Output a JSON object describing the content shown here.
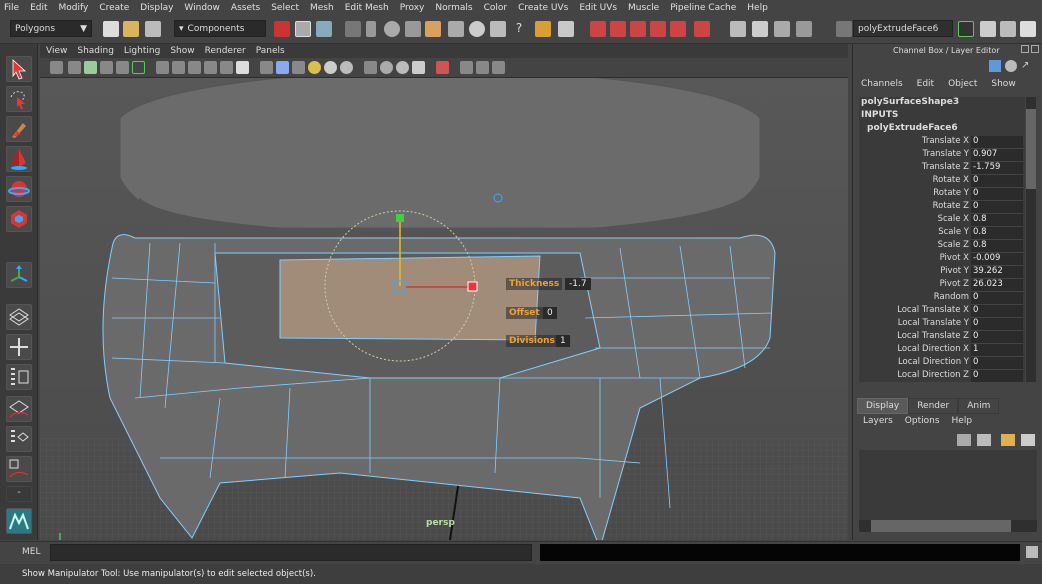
{
  "menubar": {
    "items": [
      "File",
      "Edit",
      "Modify",
      "Create",
      "Display",
      "Window",
      "Assets",
      "Select",
      "Mesh",
      "Edit Mesh",
      "Proxy",
      "Normals",
      "Color",
      "Create UVs",
      "Edit UVs",
      "Muscle",
      "Pipeline Cache",
      "Help"
    ]
  },
  "toolbar": {
    "mode": "Polygons",
    "selection_mode": "Components",
    "object_field": "polyExtrudeFace6"
  },
  "panel_menu": {
    "items": [
      "View",
      "Shading",
      "Lighting",
      "Show",
      "Renderer",
      "Panels"
    ]
  },
  "viewport": {
    "camera_label": "persp",
    "hud": {
      "thickness_label": "Thickness",
      "thickness_value": "-1.7",
      "offset_label": "Offset",
      "offset_value": "0",
      "divisions_label": "Divisions",
      "divisions_value": "1"
    }
  },
  "channel_box": {
    "title": "Channel Box / Layer Editor",
    "menu": [
      "Channels",
      "Edit",
      "Object",
      "Show"
    ],
    "shape_name": "polySurfaceShape3",
    "inputs_label": "INPUTS",
    "node_name": "polyExtrudeFace6",
    "attributes": [
      {
        "label": "Translate X",
        "value": "0"
      },
      {
        "label": "Translate Y",
        "value": "0.907"
      },
      {
        "label": "Translate Z",
        "value": "-1.759"
      },
      {
        "label": "Rotate X",
        "value": "0"
      },
      {
        "label": "Rotate Y",
        "value": "0"
      },
      {
        "label": "Rotate Z",
        "value": "0"
      },
      {
        "label": "Scale X",
        "value": "0.8"
      },
      {
        "label": "Scale Y",
        "value": "0.8"
      },
      {
        "label": "Scale Z",
        "value": "0.8"
      },
      {
        "label": "Pivot X",
        "value": "-0.009"
      },
      {
        "label": "Pivot Y",
        "value": "39.262"
      },
      {
        "label": "Pivot Z",
        "value": "26.023"
      },
      {
        "label": "Random",
        "value": "0"
      },
      {
        "label": "Local Translate X",
        "value": "0"
      },
      {
        "label": "Local Translate Y",
        "value": "0"
      },
      {
        "label": "Local Translate Z",
        "value": "0"
      },
      {
        "label": "Local Direction X",
        "value": "1"
      },
      {
        "label": "Local Direction Y",
        "value": "0"
      },
      {
        "label": "Local Direction Z",
        "value": "0"
      }
    ]
  },
  "layer_editor": {
    "tabs": [
      "Display",
      "Render",
      "Anim"
    ],
    "menu": [
      "Layers",
      "Options",
      "Help"
    ]
  },
  "command_line": {
    "label": "MEL"
  },
  "help_line": {
    "text": "Show Manipulator Tool: Use manipulator(s) to edit selected object(s)."
  }
}
